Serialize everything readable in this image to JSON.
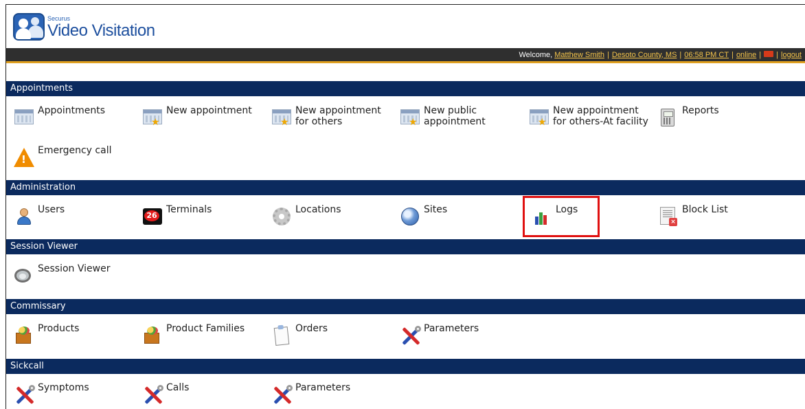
{
  "app": {
    "brand_small": "Securus",
    "brand_main": "Video Visitation"
  },
  "topbar": {
    "welcome_prefix": "Welcome, ",
    "user_name": "Matthew Smith",
    "facility": "Desoto County, MS",
    "time": "06:58 PM CT",
    "status": "online",
    "logout": "logout",
    "separator": "|"
  },
  "sections": {
    "appointments": {
      "title": "Appointments",
      "items": [
        "Appointments",
        "New appointment",
        "New appointment for others",
        "New public appointment",
        "New appointment for others-At facility",
        "Reports",
        "Emergency call"
      ]
    },
    "administration": {
      "title": "Administration",
      "items": [
        "Users",
        "Terminals",
        "Locations",
        "Sites",
        "Logs",
        "Block List"
      ],
      "terminals_badge": "26"
    },
    "session_viewer": {
      "title": "Session Viewer",
      "items": [
        "Session Viewer"
      ]
    },
    "commissary": {
      "title": "Commissary",
      "items": [
        "Products",
        "Product Families",
        "Orders",
        "Parameters"
      ]
    },
    "sickcall": {
      "title": "Sickcall",
      "items": [
        "Symptoms",
        "Calls",
        "Parameters"
      ]
    }
  },
  "icons": {
    "appointments": "calendar-icon",
    "new_appointment": "calendar-star-icon",
    "reports": "calculator-icon",
    "emergency_call": "warning-icon",
    "users": "user-icon",
    "terminals": "terminal-icon",
    "locations": "gear-icon",
    "sites": "globe-icon",
    "logs": "bar-chart-icon",
    "block_list": "document-block-icon",
    "session_viewer": "magnifier-icon",
    "products": "product-box-icon",
    "orders": "clipboard-icon",
    "parameters": "tools-icon"
  },
  "colors": {
    "section_header_bg": "#0b2a5e",
    "topbar_bg": "#2f2f2f",
    "topbar_link": "#f3c34a",
    "topbar_accent": "#e0a020",
    "highlight_border": "#e01010",
    "brand_blue": "#1d4f9e"
  }
}
